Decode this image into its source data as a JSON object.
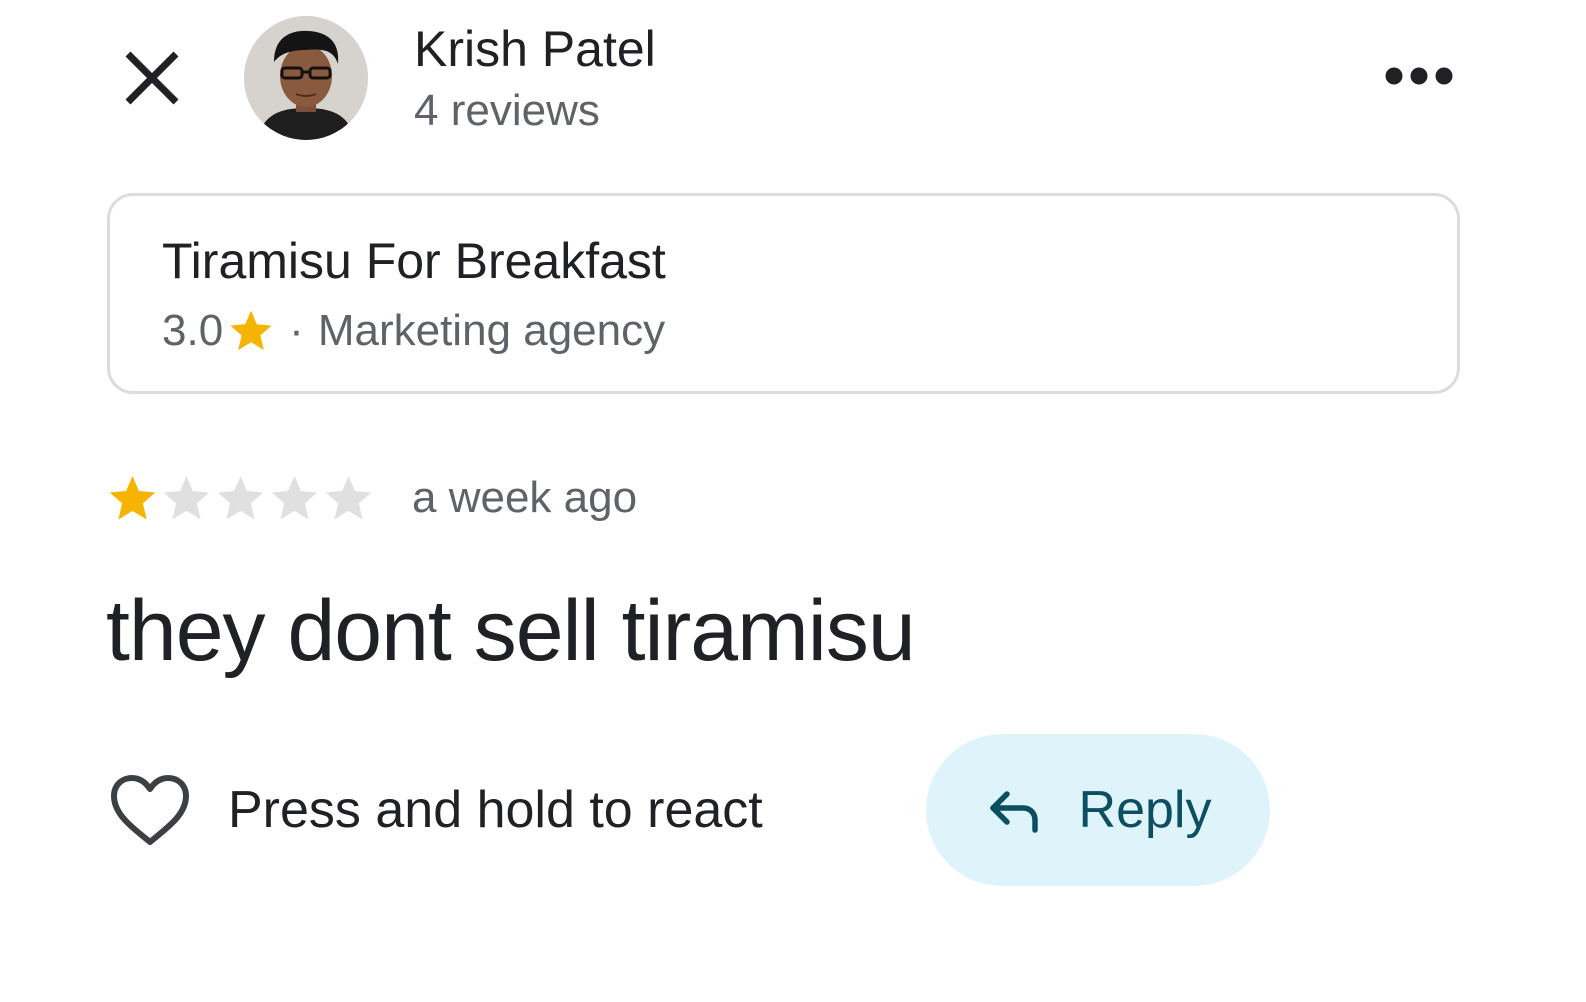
{
  "header": {
    "author_name": "Krish Patel",
    "author_reviews": "4 reviews",
    "close_icon": "close-icon",
    "more_icon": "more-horizontal-icon"
  },
  "place": {
    "name": "Tiramisu For Breakfast",
    "rating": "3.0",
    "separator": "·",
    "category": "Marketing agency"
  },
  "review": {
    "stars_filled": 1,
    "stars_total": 5,
    "date": "a week ago",
    "text": "they dont sell tiramisu"
  },
  "actions": {
    "react_label": "Press and hold to react",
    "reply_label": "Reply"
  },
  "colors": {
    "star_filled": "#F4B400",
    "star_empty": "#E0E0E0",
    "reply_bg": "#DEF4FA",
    "reply_text": "#0B4F61",
    "secondary_text": "#5F6368",
    "primary_text": "#202124"
  }
}
